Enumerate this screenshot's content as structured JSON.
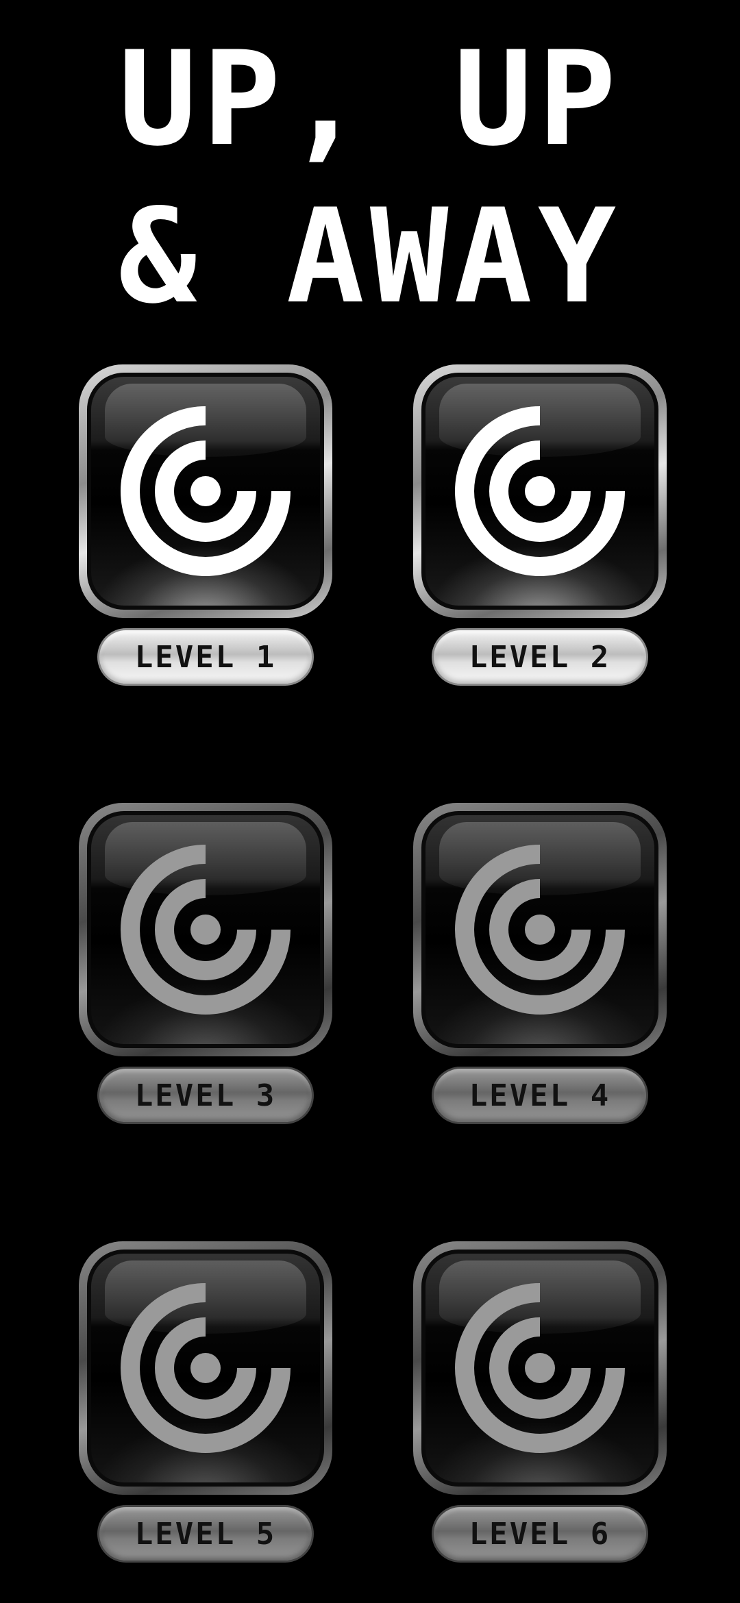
{
  "title": {
    "line1": "UP, UP",
    "line2": "& AWAY"
  },
  "colors": {
    "background": "#000000",
    "title": "#ffffff",
    "emblem_unlocked": "#ffffff",
    "emblem_locked": "#9a9a9a",
    "label_text": "#111111"
  },
  "levels": [
    {
      "label": "LEVEL 1",
      "state": "unlocked",
      "icon": "spiral-target-icon"
    },
    {
      "label": "LEVEL 2",
      "state": "unlocked",
      "icon": "spiral-target-icon"
    },
    {
      "label": "LEVEL 3",
      "state": "locked",
      "icon": "spiral-target-icon"
    },
    {
      "label": "LEVEL 4",
      "state": "locked",
      "icon": "spiral-target-icon"
    },
    {
      "label": "LEVEL 5",
      "state": "locked",
      "icon": "spiral-target-icon"
    },
    {
      "label": "LEVEL 6",
      "state": "locked",
      "icon": "spiral-target-icon"
    }
  ]
}
